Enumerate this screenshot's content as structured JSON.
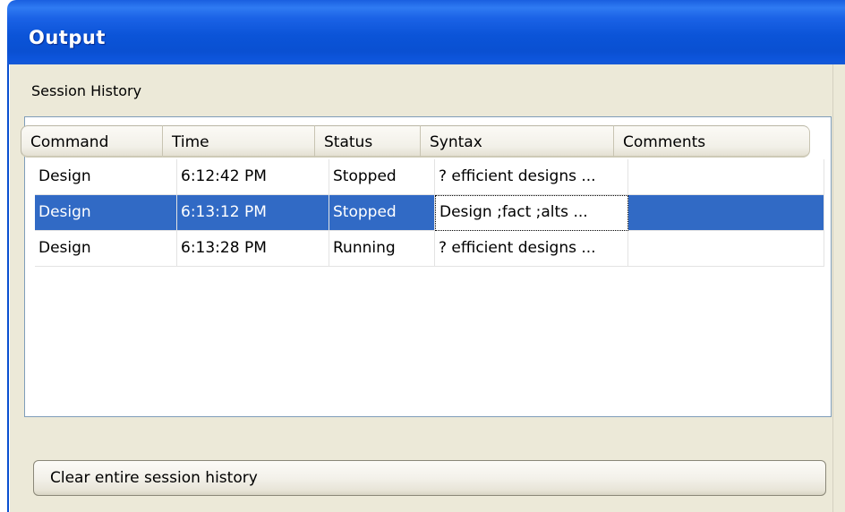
{
  "window": {
    "title": "Output"
  },
  "panel": {
    "section_label": "Session History"
  },
  "table": {
    "columns": [
      "Command",
      "Time",
      "Status",
      "Syntax",
      "Comments"
    ],
    "rows": [
      {
        "command": "Design",
        "time": "6:12:42 PM",
        "status": "Stopped",
        "syntax": "? efficient designs ...",
        "comments": ""
      },
      {
        "command": "Design",
        "time": "6:13:12 PM",
        "status": "Stopped",
        "syntax": "Design ;fact ;alts ...",
        "comments": ""
      },
      {
        "command": "Design",
        "time": "6:13:28 PM",
        "status": "Running",
        "syntax": "? efficient designs ...",
        "comments": ""
      }
    ],
    "selected_row_index": 1
  },
  "actions": {
    "clear_label": "Clear entire session history"
  },
  "colors": {
    "titlebar": "#0a50d2",
    "selection": "#316ac5",
    "face": "#ece9d8"
  }
}
